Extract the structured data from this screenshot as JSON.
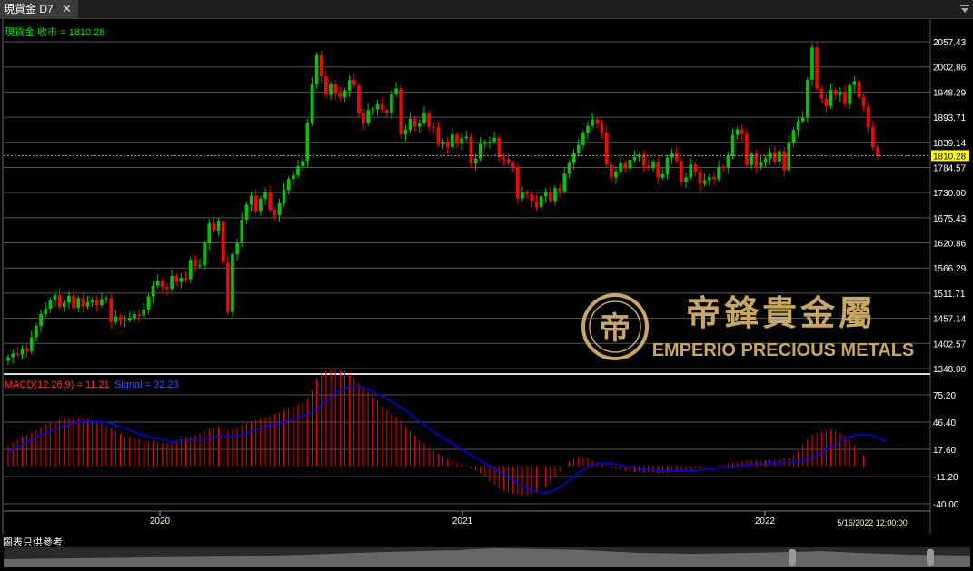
{
  "tab": {
    "title": "現貨金 D7",
    "close_glyph": "✕"
  },
  "chart_data": [
    {
      "type": "candlestick",
      "legend": "現貨金 收市 = 1810.28",
      "last_value": 1810.28,
      "last_value_label": "1810.28",
      "y_ticks": [
        "2057.43",
        "2002.86",
        "1948.29",
        "1893.71",
        "1839.14",
        "1784.57",
        "1730.00",
        "1675.43",
        "1620.86",
        "1566.29",
        "1511.71",
        "1457.14",
        "1402.57",
        "1348.00"
      ],
      "ylim": [
        1348.0,
        2057.43
      ],
      "x_ticks": [
        "2020",
        "2021",
        "2022"
      ],
      "x_end_label": "5/16/2022 12:00:00",
      "colors": {
        "up": "#00c800",
        "down": "#ff0000",
        "last_line": "#ff9900",
        "last_box": "#ffff00"
      },
      "closes": [
        1373,
        1381,
        1378,
        1392,
        1386,
        1416,
        1441,
        1466,
        1478,
        1497,
        1508,
        1482,
        1491,
        1506,
        1480,
        1501,
        1483,
        1492,
        1497,
        1486,
        1499,
        1501,
        1449,
        1461,
        1452,
        1454,
        1458,
        1466,
        1463,
        1476,
        1505,
        1528,
        1539,
        1525,
        1521,
        1549,
        1536,
        1545,
        1542,
        1584,
        1571,
        1572,
        1620,
        1663,
        1647,
        1669,
        1578,
        1471,
        1596,
        1620,
        1671,
        1704,
        1723,
        1690,
        1717,
        1731,
        1693,
        1681,
        1707,
        1736,
        1760,
        1768,
        1787,
        1799,
        1880,
        1966,
        2028,
        1982,
        1942,
        1965,
        1946,
        1937,
        1952,
        1974,
        1963,
        1902,
        1880,
        1909,
        1911,
        1922,
        1909,
        1903,
        1943,
        1956,
        1856,
        1866,
        1890,
        1873,
        1880,
        1903,
        1873,
        1872,
        1835,
        1841,
        1829,
        1856,
        1836,
        1848,
        1851,
        1793,
        1804,
        1836,
        1840,
        1841,
        1849,
        1806,
        1803,
        1794,
        1785,
        1718,
        1731,
        1726,
        1712,
        1698,
        1722,
        1730,
        1712,
        1740,
        1733,
        1771,
        1794,
        1815,
        1833,
        1860,
        1875,
        1889,
        1879,
        1861,
        1791,
        1763,
        1776,
        1794,
        1783,
        1801,
        1807,
        1812,
        1788,
        1784,
        1797,
        1763,
        1770,
        1806,
        1816,
        1799,
        1754,
        1763,
        1791,
        1775,
        1749,
        1757,
        1764,
        1759,
        1786,
        1785,
        1809,
        1855,
        1867,
        1857,
        1790,
        1814,
        1786,
        1796,
        1804,
        1818,
        1797,
        1820,
        1779,
        1839,
        1866,
        1885,
        1893,
        1975,
        2045,
        1956,
        1934,
        1918,
        1953,
        1942,
        1948,
        1922,
        1963,
        1972,
        1937,
        1917,
        1872,
        1828,
        1810.28
      ],
      "macd": [
        21,
        25,
        28,
        31,
        33,
        35,
        38,
        41,
        44,
        46,
        47,
        49,
        50,
        51,
        51,
        51,
        50,
        49,
        48,
        47,
        45,
        43,
        40,
        37,
        34,
        31,
        30,
        29,
        28,
        27,
        26,
        26,
        25,
        24,
        24,
        25,
        27,
        29,
        30,
        31,
        33,
        35,
        37,
        39,
        40,
        41,
        39,
        37,
        39,
        41,
        43,
        45,
        47,
        49,
        50,
        51,
        53,
        55,
        57,
        59,
        61,
        63,
        65,
        67,
        72,
        80,
        92,
        99,
        101,
        102,
        102,
        101,
        100,
        97,
        93,
        88,
        83,
        79,
        74,
        69,
        63,
        59,
        55,
        52,
        48,
        42,
        37,
        32,
        27,
        24,
        20,
        16,
        13,
        10,
        7,
        5,
        3,
        2,
        1,
        -2,
        -5,
        -8,
        -12,
        -16,
        -20,
        -24,
        -26,
        -28,
        -29,
        -30,
        -31,
        -31,
        -30,
        -28,
        -26,
        -22,
        -18,
        -12,
        -6,
        0,
        5,
        8,
        10,
        10,
        8,
        6,
        4,
        2,
        0,
        -2,
        -3,
        -4,
        -5,
        -5,
        -6,
        -6,
        -7,
        -7,
        -7,
        -8,
        -8,
        -7,
        -6,
        -5,
        -5,
        -5,
        -4,
        -3,
        -2,
        -1,
        0,
        0,
        1,
        1,
        2,
        3,
        4,
        5,
        6,
        6,
        6,
        5,
        6,
        6,
        6,
        7,
        8,
        9,
        12,
        16,
        22,
        28,
        33,
        35,
        36,
        37,
        38,
        37,
        35,
        32,
        28,
        22,
        15,
        11
      ],
      "signal": [
        15,
        17,
        20,
        23,
        26,
        28,
        31,
        33,
        35,
        37,
        39,
        41,
        42,
        44,
        45,
        46,
        47,
        47,
        47,
        47,
        47,
        46,
        45,
        43,
        42,
        40,
        38,
        36,
        34,
        33,
        31,
        30,
        29,
        28,
        27,
        26,
        26,
        27,
        27,
        27,
        28,
        29,
        29,
        30,
        31,
        31,
        31,
        31,
        31,
        32,
        33,
        35,
        37,
        38,
        40,
        42,
        43,
        44,
        45,
        47,
        48,
        49,
        51,
        53,
        55,
        58,
        61,
        65,
        69,
        73,
        77,
        80,
        82,
        84,
        84,
        84,
        83,
        81,
        79,
        76,
        74,
        71,
        68,
        65,
        62,
        59,
        55,
        51,
        47,
        44,
        40,
        36,
        33,
        30,
        27,
        24,
        21,
        18,
        15,
        12,
        9,
        6,
        3,
        0,
        -3,
        -6,
        -9,
        -12,
        -15,
        -18,
        -21,
        -24,
        -26,
        -27,
        -28,
        -28,
        -27,
        -25,
        -22,
        -19,
        -15,
        -11,
        -7,
        -4,
        -1,
        1,
        2,
        3,
        3,
        3,
        2,
        1,
        0,
        -1,
        -2,
        -3,
        -3,
        -4,
        -4,
        -5,
        -5,
        -5,
        -5,
        -5,
        -5,
        -5,
        -5,
        -5,
        -4,
        -4,
        -3,
        -3,
        -2,
        -2,
        -1,
        -1,
        0,
        0,
        1,
        1,
        2,
        2,
        2,
        3,
        3,
        3,
        4,
        4,
        4,
        5,
        6,
        7,
        9,
        11,
        14,
        17,
        20,
        23,
        26,
        28,
        31,
        32,
        33,
        33,
        33,
        32,
        30,
        28,
        26
      ],
      "macd_label": "MACD(12,26,9) = 11.21",
      "signal_label": "Signal = 32.23",
      "macd_ticks": [
        "75.20",
        "46.40",
        "17.60",
        "-11.20",
        "-40.00"
      ],
      "macd_ylim": [
        -40.0,
        75.2
      ],
      "macd_colors": {
        "histogram": "#ff0000",
        "signal": "#0000ff"
      }
    }
  ],
  "watermark": {
    "cn": "帝鋒貴金屬",
    "en": "EMPERIO PRECIOUS METALS",
    "logo_glyph": "帝"
  },
  "footer": {
    "note": "圖表只供參考"
  }
}
